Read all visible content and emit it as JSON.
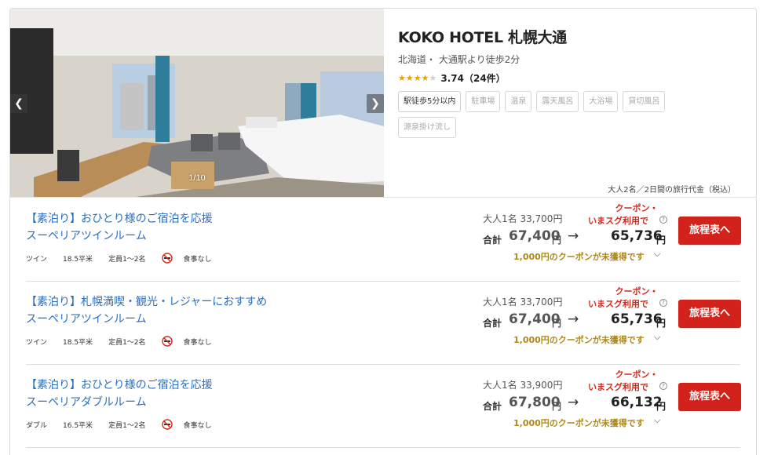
{
  "hotel": {
    "name": "KOKO HOTEL 札幌大通",
    "location": "北海道・ 大通駅より徒歩2分",
    "rating_score": "3.74（24件）",
    "rating_value": 3.74,
    "rating_max": 5,
    "photo_counter": "1/10",
    "price_note": "大人2名／2日間の旅行代金（税込）",
    "tags": [
      {
        "label": "駅徒歩5分以内",
        "active": true
      },
      {
        "label": "駐車場",
        "active": false
      },
      {
        "label": "温泉",
        "active": false
      },
      {
        "label": "露天風呂",
        "active": false
      },
      {
        "label": "大浴場",
        "active": false
      },
      {
        "label": "貸切風呂",
        "active": false
      },
      {
        "label": "源泉掛け流し",
        "active": false
      }
    ]
  },
  "icons": {
    "prev": "chevron-left-icon",
    "next": "chevron-right-icon",
    "help": "question-circle-icon",
    "nosmoke": "no-smoking-icon",
    "expand": "chevron-down-icon"
  },
  "colors": {
    "link": "#2a6fbf",
    "coupon_red": "#d42a1e",
    "coupon_gold": "#b0881a",
    "button_red": "#d3221b",
    "star": "#e8a200"
  },
  "plans": [
    {
      "title1": "【素泊り】おひとり様のご宿泊を応援",
      "title2": "スーペリアツインルーム",
      "room_type": "ツイン",
      "size": "18.5平米",
      "capacity": "定員1〜2名",
      "meal": "食事なし",
      "per_person": "大人1名 33,700円",
      "total_label": "合計",
      "total_value": "67,400",
      "yen": "円",
      "arrow": "→",
      "coupon_line1": "クーポン・",
      "coupon_line2": "いまスグ利用で",
      "final_value": "65,736",
      "coupon_note": "1,000円のクーポンが未獲得です",
      "button": "旅程表へ"
    },
    {
      "title1": "【素泊り】札幌満喫・観光・レジャーにおすすめ",
      "title2": "スーペリアツインルーム",
      "room_type": "ツイン",
      "size": "18.5平米",
      "capacity": "定員1〜2名",
      "meal": "食事なし",
      "per_person": "大人1名 33,700円",
      "total_label": "合計",
      "total_value": "67,400",
      "yen": "円",
      "arrow": "→",
      "coupon_line1": "クーポン・",
      "coupon_line2": "いまスグ利用で",
      "final_value": "65,736",
      "coupon_note": "1,000円のクーポンが未獲得です",
      "button": "旅程表へ"
    },
    {
      "title1": "【素泊り】おひとり様のご宿泊を応援",
      "title2": "スーペリアダブルルーム",
      "room_type": "ダブル",
      "size": "16.5平米",
      "capacity": "定員1〜2名",
      "meal": "食事なし",
      "per_person": "大人1名 33,900円",
      "total_label": "合計",
      "total_value": "67,800",
      "yen": "円",
      "arrow": "→",
      "coupon_line1": "クーポン・",
      "coupon_line2": "いまスグ利用で",
      "final_value": "66,132",
      "coupon_note": "1,000円のクーポンが未獲得です",
      "button": "旅程表へ"
    }
  ]
}
